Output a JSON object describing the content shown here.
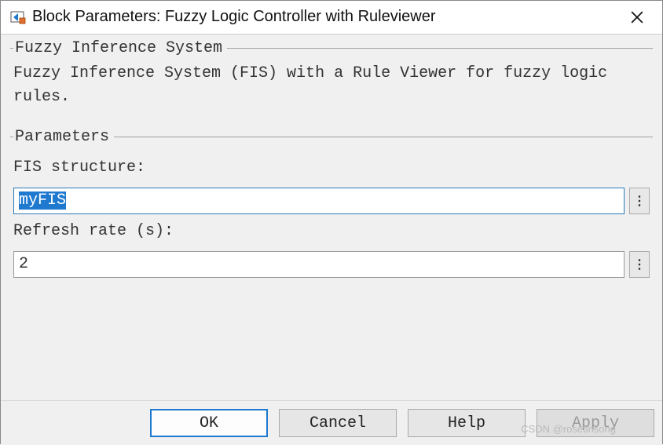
{
  "titlebar": {
    "title": "Block Parameters: Fuzzy Logic Controller with Ruleviewer"
  },
  "section_fis": {
    "title": "Fuzzy Inference System",
    "description": "Fuzzy Inference System (FIS) with a Rule Viewer for fuzzy logic rules."
  },
  "section_params": {
    "title": "Parameters",
    "fis_structure": {
      "label": "FIS structure:",
      "value": "myFIS"
    },
    "refresh_rate": {
      "label": "Refresh rate (s):",
      "value": "2"
    }
  },
  "footer": {
    "ok": "OK",
    "cancel": "Cancel",
    "help": "Help",
    "apply": "Apply"
  },
  "watermark": "CSDN @rosetinsong"
}
